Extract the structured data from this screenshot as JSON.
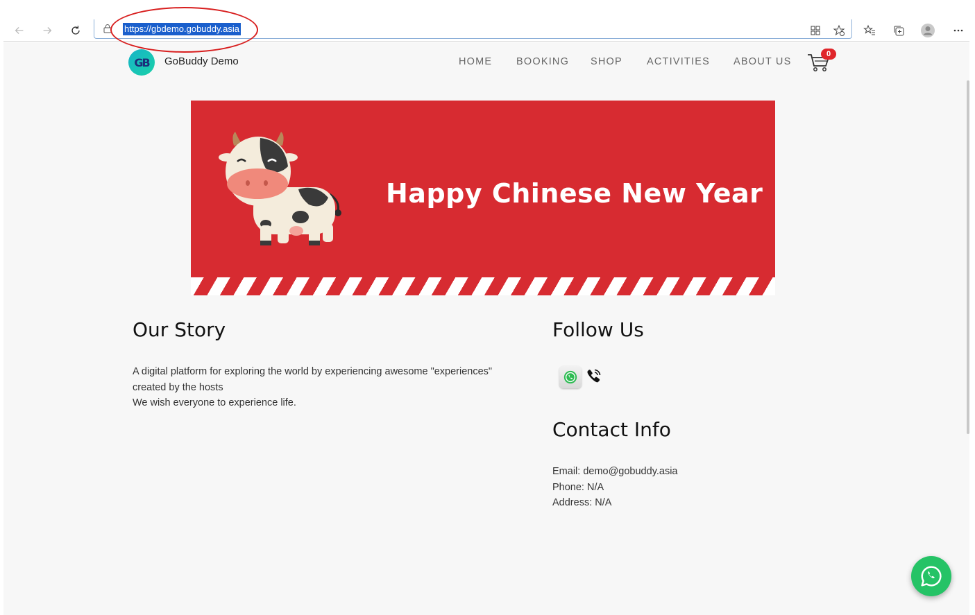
{
  "browser": {
    "url": "https://gbdemo.gobuddy.asia",
    "icons": [
      "back-arrow-icon",
      "forward-arrow-icon",
      "refresh-icon",
      "lock-icon",
      "apps-icon",
      "add-favorite-icon",
      "favorites-icon",
      "collections-icon",
      "profile-icon",
      "more-icon"
    ]
  },
  "header": {
    "logo_text": "GB",
    "brand": "GoBuddy Demo",
    "menu": [
      "HOME",
      "BOOKING",
      "SHOP",
      "ACTIVITIES",
      "ABOUT US"
    ],
    "cart_count": "0"
  },
  "banner": {
    "title": "Happy Chinese New Year"
  },
  "our_story": {
    "heading": "Our Story",
    "line1": "A digital platform for exploring the world by experiencing awesome \"experiences\"",
    "line2": "created by the hosts",
    "line3": "We wish everyone to experience life."
  },
  "follow_us": {
    "heading": "Follow Us",
    "icons": [
      "whatsapp-icon",
      "phone-icon"
    ]
  },
  "contact": {
    "heading": "Contact Info",
    "email": "Email: demo@gobuddy.asia",
    "phone": "Phone: N/A",
    "address": "Address: N/A"
  },
  "colors": {
    "banner_red": "#d72b31",
    "whatsapp_green": "#25c366",
    "url_highlight": "#1a5fcc",
    "annotation_red": "#d81f1f"
  }
}
